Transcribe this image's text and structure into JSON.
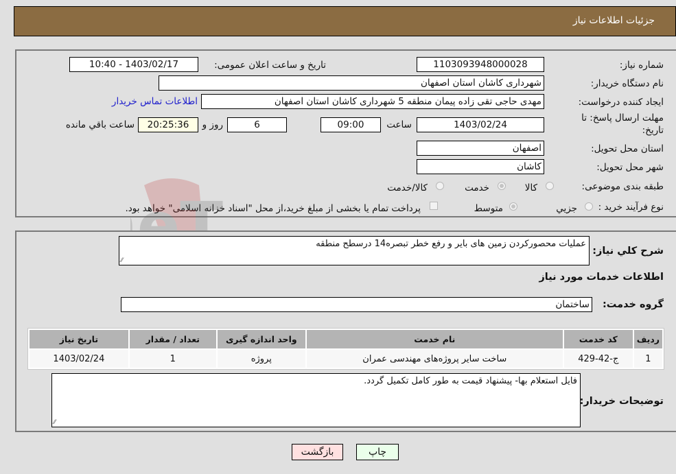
{
  "header": {
    "title": "جزئیات اطلاعات نیاز"
  },
  "fields": {
    "need_number": {
      "label": "شماره نیاز:",
      "value": "1103093948000028"
    },
    "announce_datetime": {
      "label": "تاریخ و ساعت اعلان عمومی:",
      "value": "1403/02/17 - 10:40"
    },
    "buyer_org": {
      "label": "نام دستگاه خریدار:",
      "value": "شهرداری کاشان استان اصفهان"
    },
    "requester": {
      "label": "ایجاد کننده درخواست:",
      "value": "مهدی حاجی تقی زاده پیمان منطقه 5 شهرداری کاشان استان اصفهان"
    },
    "buyer_contact_link": "اطلاعات تماس خریدار",
    "deadline": {
      "label_line1": "مهلت ارسال پاسخ: تا",
      "label_line2": "تاریخ:",
      "date": "1403/02/24",
      "time_label": "ساعت",
      "time": "09:00",
      "days": "6",
      "days_label": "روز و",
      "remaining": "20:25:36",
      "remaining_label": "ساعت باقي مانده"
    },
    "delivery_province": {
      "label": "استان محل تحویل:",
      "value": "اصفهان"
    },
    "delivery_city": {
      "label": "شهر محل تحویل:",
      "value": "کاشان"
    },
    "category": {
      "label": "طبقه بندی موضوعی:",
      "options": [
        {
          "label": "کالا",
          "selected": false
        },
        {
          "label": "خدمت",
          "selected": true
        },
        {
          "label": "کالا/خدمت",
          "selected": false
        }
      ]
    },
    "purchase_process": {
      "label": "نوع فرآیند خرید :",
      "options": [
        {
          "label": "جزيي",
          "selected": false
        },
        {
          "label": "متوسط",
          "selected": true
        }
      ],
      "treasury_checkbox_label": "پرداخت تمام یا بخشی از مبلغ خرید،از محل \"اسناد خزانه اسلامی\" خواهد بود.",
      "treasury_checked": false
    }
  },
  "description": {
    "label": "شرح کلي نياز:",
    "value": "عملیات محصورکردن زمین های بایر و رفع خطر تبصره14 درسطح منطقه"
  },
  "services_section_title": "اطلاعات خدمات مورد نياز",
  "service_group": {
    "label": "گروه خدمت:",
    "value": "ساختمان"
  },
  "table": {
    "columns": [
      "رديف",
      "کد خدمت",
      "نام خدمت",
      "واحد اندازه گیری",
      "تعداد / مقدار",
      "تاریخ نیاز"
    ],
    "rows": [
      [
        "1",
        "ج-42-429",
        "ساخت سایر پروژه‌های مهندسی عمران",
        "پروژه",
        "1",
        "1403/02/24"
      ]
    ]
  },
  "buyer_notes": {
    "label": "توضیحات خریدار:",
    "value": "فایل استعلام بها- پیشنهاد قیمت به طور کامل تکمیل گردد."
  },
  "buttons": {
    "print": "چاپ",
    "back": "بازگشت"
  },
  "watermark_text": "AriaTender.neT",
  "colors": {
    "header_bg": "#8b6c42",
    "print_bg": "#eaffea",
    "back_bg": "#ffe0e0",
    "link": "#2020cc"
  }
}
